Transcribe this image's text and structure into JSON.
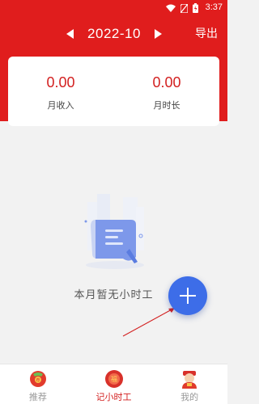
{
  "status_bar": {
    "time": "3:37"
  },
  "header": {
    "month": "2022-10",
    "export_label": "导出"
  },
  "summary": {
    "income": {
      "value": "0.00",
      "label": "月收入"
    },
    "hours": {
      "value": "0.00",
      "label": "月时长"
    }
  },
  "empty_state": {
    "text": "本月暂无小时工"
  },
  "tabs": [
    {
      "label": "推荐",
      "active": false,
      "badge_text": "荐"
    },
    {
      "label": "记小时工",
      "active": true,
      "badge_text": "福"
    },
    {
      "label": "我的",
      "active": false
    }
  ],
  "colors": {
    "brand_red": "#e01d1d",
    "fab_blue": "#3d6de8"
  }
}
